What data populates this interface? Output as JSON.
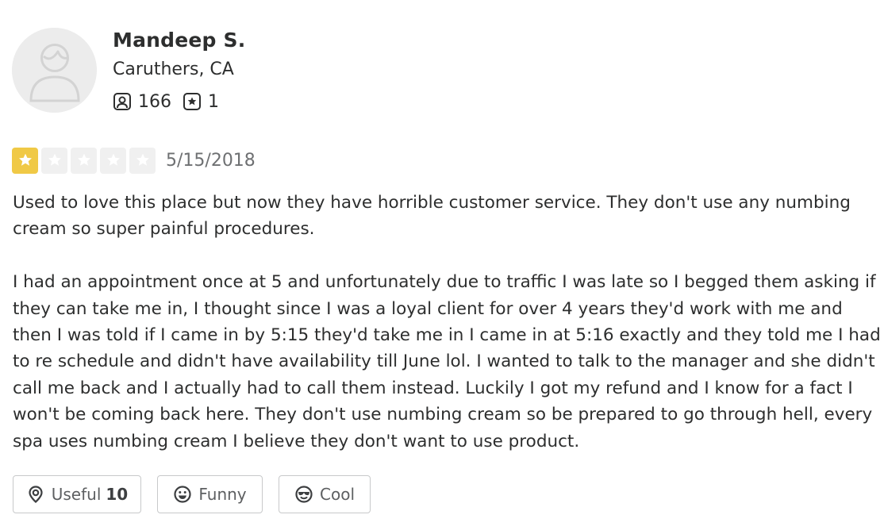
{
  "user": {
    "name": "Mandeep S.",
    "location": "Caruthers, CA",
    "avatar_icon": "default-user-avatar",
    "friends_icon": "friends-icon",
    "friends_count": "166",
    "reviews_icon": "review-star-icon",
    "reviews_count": "1"
  },
  "review": {
    "rating": 1,
    "rating_max": 5,
    "star_color": "#f0c946",
    "date": "5/15/2018",
    "paragraphs": [
      "Used to love this place but now they have horrible customer service. They don't use any numbing cream so super painful procedures.",
      "I had an appointment once at 5 and unfortunately due to traffic I was late so I begged them asking if they can take me in, I thought since I was a loyal client for over 4 years they'd work with me and then I was told if I came in by 5:15 they'd take me in I came in at 5:16 exactly and they told me I had to re schedule and didn't have availability till June lol. I wanted to talk to the manager and she didn't call me back and I actually had to call them instead. Luckily I got my refund and I know for a fact I won't be coming back here. They don't use numbing cream so be prepared to go through hell, every spa uses numbing cream I believe they don't want to use product."
    ]
  },
  "actions": {
    "useful_label": "Useful",
    "useful_count": "10",
    "useful_icon": "lightbulb-icon",
    "funny_label": "Funny",
    "funny_icon": "smile-icon",
    "cool_label": "Cool",
    "cool_icon": "sunglasses-icon"
  }
}
